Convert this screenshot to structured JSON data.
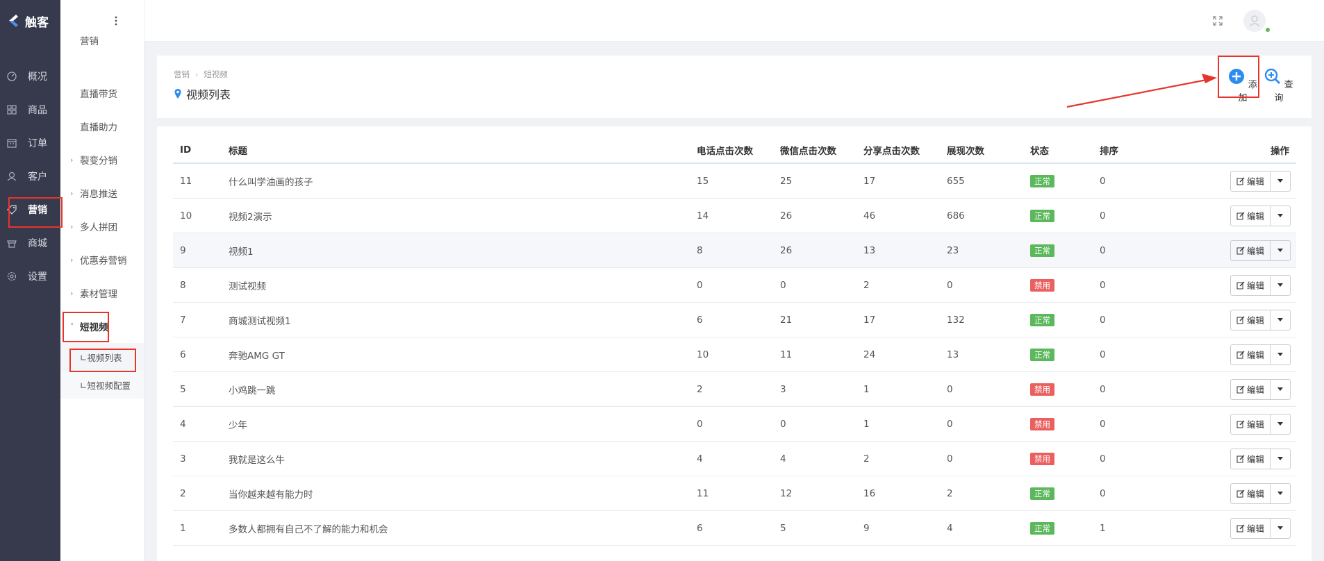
{
  "brand": {
    "name": "触客"
  },
  "nav": {
    "items": [
      {
        "label": "概况",
        "icon": "dashboard-icon"
      },
      {
        "label": "商品",
        "icon": "grid-icon"
      },
      {
        "label": "订单",
        "icon": "calendar-icon"
      },
      {
        "label": "客户",
        "icon": "user-icon"
      },
      {
        "label": "营销",
        "icon": "tag-icon"
      },
      {
        "label": "商城",
        "icon": "shop-icon"
      },
      {
        "label": "设置",
        "icon": "gear-icon"
      }
    ]
  },
  "subnav": {
    "header": "营销",
    "items": [
      {
        "label": "直播带货"
      },
      {
        "label": "直播助力"
      },
      {
        "label": "裂变分销"
      },
      {
        "label": "消息推送"
      },
      {
        "label": "多人拼团"
      },
      {
        "label": "优惠券营销"
      },
      {
        "label": "素材管理"
      },
      {
        "label": "短视频"
      }
    ],
    "leaves": [
      {
        "label": "∟视频列表"
      },
      {
        "label": "∟短视频配置"
      }
    ]
  },
  "breadcrumb": {
    "root": "营销",
    "current": "短视频"
  },
  "page": {
    "title": "视频列表"
  },
  "toolbar": {
    "add": "添加",
    "query": "查询"
  },
  "table": {
    "headers": [
      "ID",
      "标题",
      "电话点击次数",
      "微信点击次数",
      "分享点击次数",
      "展现次数",
      "状态",
      "排序",
      "操作"
    ],
    "edit_label": "编辑",
    "rows": [
      {
        "id": "11",
        "title": "什么叫学油画的孩子",
        "phone": "15",
        "wx": "25",
        "share": "17",
        "show": "655",
        "status": "正常",
        "sort": "0"
      },
      {
        "id": "10",
        "title": "视频2演示",
        "phone": "14",
        "wx": "26",
        "share": "46",
        "show": "686",
        "status": "正常",
        "sort": "0"
      },
      {
        "id": "9",
        "title": "视频1",
        "phone": "8",
        "wx": "26",
        "share": "13",
        "show": "23",
        "status": "正常",
        "sort": "0"
      },
      {
        "id": "8",
        "title": "测试视频",
        "phone": "0",
        "wx": "0",
        "share": "2",
        "show": "0",
        "status": "禁用",
        "sort": "0"
      },
      {
        "id": "7",
        "title": "商城测试视频1",
        "phone": "6",
        "wx": "21",
        "share": "17",
        "show": "132",
        "status": "正常",
        "sort": "0"
      },
      {
        "id": "6",
        "title": "奔驰AMG GT",
        "phone": "10",
        "wx": "11",
        "share": "24",
        "show": "13",
        "status": "正常",
        "sort": "0"
      },
      {
        "id": "5",
        "title": "小鸡跳一跳",
        "phone": "2",
        "wx": "3",
        "share": "1",
        "show": "0",
        "status": "禁用",
        "sort": "0"
      },
      {
        "id": "4",
        "title": "少年",
        "phone": "0",
        "wx": "0",
        "share": "1",
        "show": "0",
        "status": "禁用",
        "sort": "0"
      },
      {
        "id": "3",
        "title": "我就是这么牛",
        "phone": "4",
        "wx": "4",
        "share": "2",
        "show": "0",
        "status": "禁用",
        "sort": "0"
      },
      {
        "id": "2",
        "title": "当你越来越有能力时",
        "phone": "11",
        "wx": "12",
        "share": "16",
        "show": "2",
        "status": "正常",
        "sort": "0"
      },
      {
        "id": "1",
        "title": "多数人都拥有自己不了解的能力和机会",
        "phone": "6",
        "wx": "5",
        "share": "9",
        "show": "4",
        "status": "正常",
        "sort": "1"
      }
    ]
  },
  "colors": {
    "nav_bg": "#363a4c",
    "accent": "#2d8cf0",
    "ok": "#5cb85c",
    "off": "#e9605f",
    "annotation": "#e8352b"
  }
}
